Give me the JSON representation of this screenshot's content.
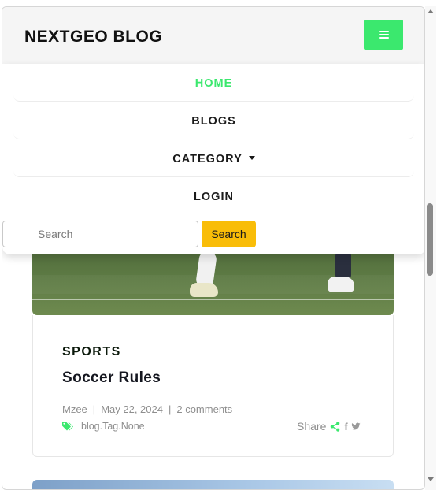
{
  "header": {
    "brand": "NEXTGEO BLOG",
    "menu_icon": "hamburger-menu-icon"
  },
  "nav": {
    "items": [
      {
        "label": "HOME",
        "active": true
      },
      {
        "label": "BLOGS",
        "active": false
      },
      {
        "label": "CATEGORY",
        "active": false,
        "has_dropdown": true
      },
      {
        "label": "LOGIN",
        "active": false
      }
    ]
  },
  "search": {
    "placeholder": "Search",
    "button_label": "Search"
  },
  "post": {
    "category": "SPORTS",
    "title": "Soccer Rules",
    "author": "Mzee",
    "date": "May 22, 2024",
    "comments": "2 comments",
    "tags": "blog.Tag.None",
    "share_label": "Share",
    "facebook_glyph": "f"
  },
  "colors": {
    "accent_green": "#3be86e",
    "search_button": "#f9bd08",
    "header_bg": "#f5f5f5"
  }
}
